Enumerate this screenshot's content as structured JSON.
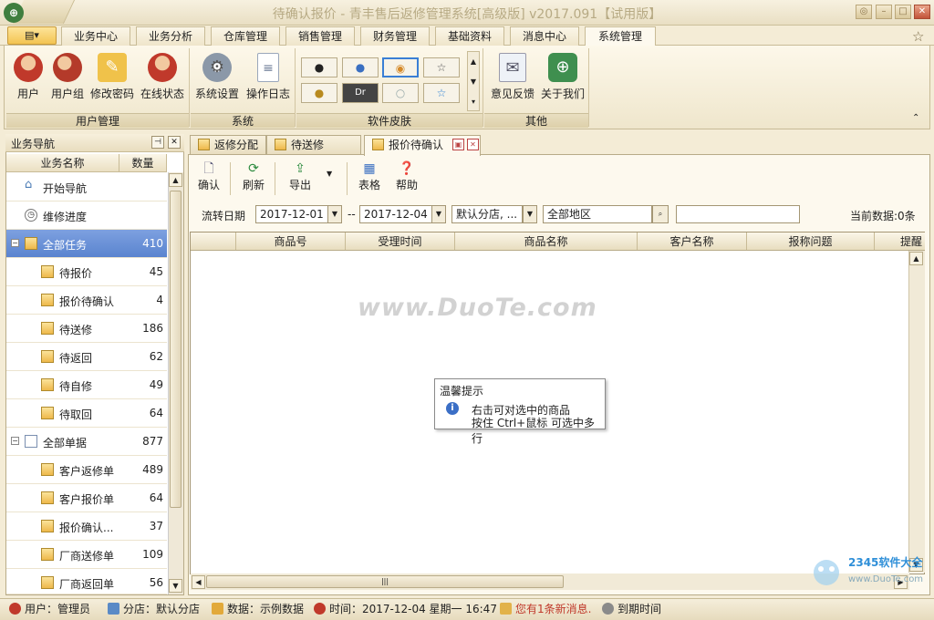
{
  "window": {
    "title": "待确认报价 - 青丰售后返修管理系统[高级版] v2017.091【试用版】",
    "app_logo": "⊕",
    "menu_button": "▤▾"
  },
  "menu_tabs": [
    "业务中心",
    "业务分析",
    "仓库管理",
    "销售管理",
    "财务管理",
    "基础资料",
    "消息中心",
    "系统管理"
  ],
  "ribbon": {
    "groups": {
      "user_mgmt": {
        "label": "用户管理",
        "buttons": [
          "用户",
          "用户组",
          "修改密码",
          "在线状态"
        ]
      },
      "system": {
        "label": "系统",
        "buttons": [
          "系统设置",
          "操作日志"
        ]
      },
      "skins": {
        "label": "软件皮肤",
        "items": [
          "●",
          "●",
          "◉",
          "☆",
          "●",
          "Dr",
          "○",
          "☆"
        ]
      },
      "other": {
        "label": "其他",
        "buttons": [
          "意见反馈",
          "关于我们"
        ]
      }
    }
  },
  "nav": {
    "title": "业务导航",
    "columns": [
      "业务名称",
      "数量"
    ],
    "items": [
      {
        "name": "开始导航",
        "count": ""
      },
      {
        "name": "维修进度",
        "count": ""
      },
      {
        "name": "全部任务",
        "count": "410"
      },
      {
        "name": "待报价",
        "count": "45"
      },
      {
        "name": "报价待确认",
        "count": "4"
      },
      {
        "name": "待送修",
        "count": "186"
      },
      {
        "name": "待返回",
        "count": "62"
      },
      {
        "name": "待自修",
        "count": "49"
      },
      {
        "name": "待取回",
        "count": "64"
      },
      {
        "name": "全部单据",
        "count": "877"
      },
      {
        "name": "客户返修单",
        "count": "489"
      },
      {
        "name": "客户报价单",
        "count": "64"
      },
      {
        "name": "报价确认...",
        "count": "37"
      },
      {
        "name": "厂商送修单",
        "count": "109"
      },
      {
        "name": "厂商返回单",
        "count": "56"
      }
    ]
  },
  "doc_tabs": [
    "返修分配",
    "待送修",
    "报价待确认"
  ],
  "toolbar": {
    "buttons": [
      "确认",
      "刷新",
      "导出",
      "表格",
      "帮助"
    ]
  },
  "filter": {
    "date_label": "流转日期",
    "date_from": "2017-12-01",
    "sep": "--",
    "date_to": "2017-12-04",
    "branch": "默认分店, ...",
    "region": "全部地区",
    "search": "",
    "current": "当前数据:0条"
  },
  "grid": {
    "columns": [
      "",
      "商品号",
      "受理时间",
      "商品名称",
      "客户名称",
      "报称问题",
      "提醒"
    ]
  },
  "watermark": "www.DuoTe.com",
  "tooltip": {
    "title": "温馨提示",
    "line1": "右击可对选中的商品",
    "line2": "按住 Ctrl+鼠标 可选中多行"
  },
  "logo2345": {
    "brand": "2345软件大全",
    "url": "www.DuoTe.com"
  },
  "status": {
    "user": "用户：管理员",
    "branch": "分店：默认分店",
    "data": "数据：示例数据",
    "time": "时间：2017-12-04 星期一 16:47",
    "msg": "您有1条新消息.",
    "expire": "到期时间"
  }
}
